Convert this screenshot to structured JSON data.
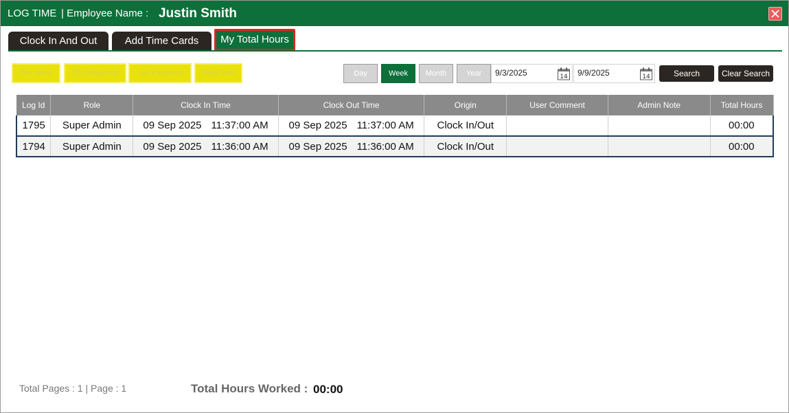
{
  "title": {
    "app": "LOG TIME",
    "employee_label": "| Employee Name :",
    "employee_name": "Justin Smith"
  },
  "tabs": [
    {
      "label": "Clock In And Out"
    },
    {
      "label": "Add Time Cards"
    },
    {
      "label": "My Total Hours",
      "active": true
    }
  ],
  "quick_filters": [
    "This Week",
    "This Payperiod",
    "Last Payperiod",
    "Daily Total"
  ],
  "range_buttons": [
    {
      "label": "Day"
    },
    {
      "label": "Week",
      "selected": true
    },
    {
      "label": "Month"
    },
    {
      "label": "Year"
    }
  ],
  "date_from": "9/3/2025",
  "date_to": "9/9/2025",
  "calendar_icon_day": "14",
  "search_label": "Search",
  "clear_label": "Clear Search",
  "table": {
    "headers": [
      "Log Id",
      "Role",
      "Clock In Time",
      "Clock Out Time",
      "Origin",
      "User Comment",
      "Admin Note",
      "Total Hours"
    ],
    "rows": [
      {
        "log_id": "1795",
        "role": "Super Admin",
        "in_date": "09 Sep 2025",
        "in_time": "11:37:00 AM",
        "out_date": "09 Sep 2025",
        "out_time": "11:37:00 AM",
        "origin": "Clock In/Out",
        "user_comment": "",
        "admin_note": "",
        "total": "00:00"
      },
      {
        "log_id": "1794",
        "role": "Super Admin",
        "in_date": "09 Sep 2025",
        "in_time": "11:36:00 AM",
        "out_date": "09 Sep 2025",
        "out_time": "11:36:00 AM",
        "origin": "Clock In/Out",
        "user_comment": "",
        "admin_note": "",
        "total": "00:00"
      }
    ]
  },
  "footer": {
    "pages": "Total Pages : 1 | Page : 1",
    "total_label": "Total Hours Worked :",
    "total_value": "00:00"
  },
  "colors": {
    "brand_green": "#0d6f3a",
    "dark_button": "#2b2622",
    "highlight_yellow": "#e9e10b",
    "active_tab_border": "#d6281d"
  },
  "icons": {
    "close": "close-icon",
    "calendar": "calendar-icon"
  }
}
